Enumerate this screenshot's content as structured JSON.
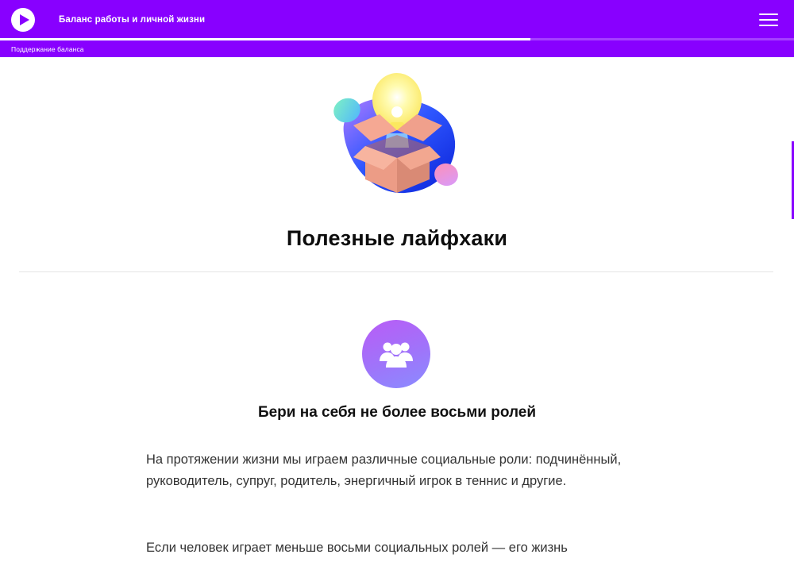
{
  "header": {
    "course_title": "Баланс работы и личной жизни",
    "section_label": "Поддержание баланса",
    "progress_fraction": 0.668,
    "logo_icon": "play-icon",
    "menu_icon": "hamburger-menu-icon",
    "background_color": "#8800ff"
  },
  "main": {
    "hero_illustration": "lightbulb-box-icon",
    "page_title": "Полезные лайфхаки",
    "tip": {
      "icon": "people-group-icon",
      "title": "Бери на себя не более восьми ролей",
      "paragraphs": [
        "На протяжении жизни мы играем различные социальные роли: подчинённый, руководитель, супруг, родитель, энергичный игрок в теннис и другие.",
        "Если человек играет меньше восьми социальных ролей — его жизнь"
      ]
    }
  }
}
